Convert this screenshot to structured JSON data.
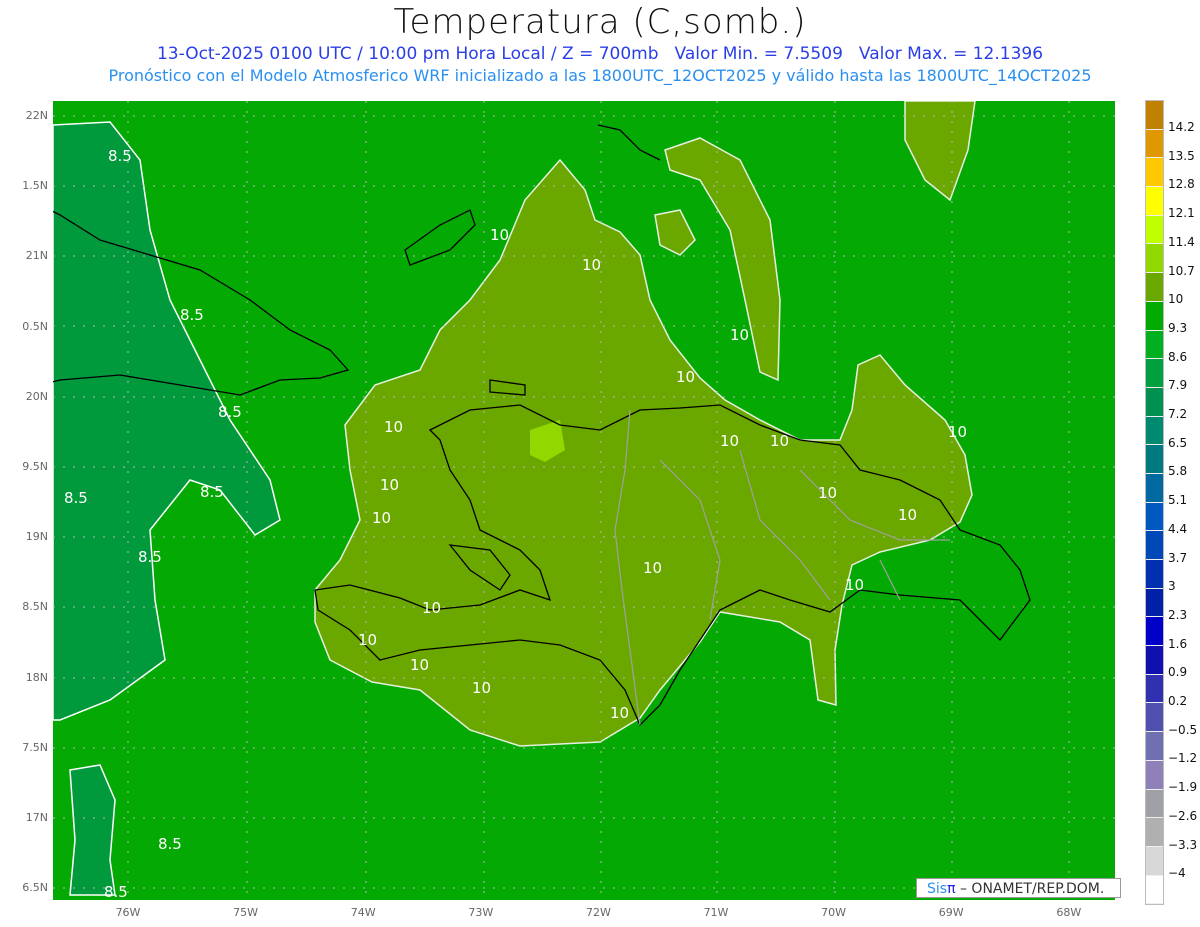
{
  "header": {
    "title": "Temperatura (C,somb.)",
    "date_line": "13-Oct-2025  0100 UTC / 10:00 pm Hora Local / Z = 700mb",
    "min_value": "Valor Min. = 7.5509",
    "max_value": "Valor Max. = 12.1396",
    "model_line": "Pronóstico con el Modelo Atmosferico WRF inicializado a las 1800UTC_12OCT2025 y válido hasta las  1800UTC_14OCT2025"
  },
  "axes": {
    "lat_labels": [
      "22N",
      "1.5N",
      "21N",
      "0.5N",
      "20N",
      "9.5N",
      "19N",
      "8.5N",
      "18N",
      "7.5N",
      "17N",
      "6.5N"
    ],
    "lon_labels": [
      "76W",
      "75W",
      "74W",
      "73W",
      "72W",
      "71W",
      "70W",
      "69W",
      "68W"
    ]
  },
  "colorbar": {
    "labels": [
      "14.2",
      "13.5",
      "12.8",
      "12.1",
      "11.4",
      "10.7",
      "10",
      "9.3",
      "8.6",
      "7.9",
      "7.2",
      "6.5",
      "5.8",
      "5.1",
      "4.4",
      "3.7",
      "3",
      "2.3",
      "1.6",
      "0.9",
      "0.2",
      "−0.5",
      "−1.2",
      "−1.9",
      "−2.6",
      "−3.3",
      "−4"
    ],
    "colors": [
      "#c08000",
      "#e09800",
      "#ffc800",
      "#ffff00",
      "#c0ff00",
      "#90d800",
      "#6aa800",
      "#00aa00",
      "#00b020",
      "#00a040",
      "#009050",
      "#008a70",
      "#007a80",
      "#006aa0",
      "#0058c0",
      "#0048b8",
      "#0030b0",
      "#0020a8",
      "#0000c8",
      "#1010b0",
      "#3030b0",
      "#5050b0",
      "#7070b0",
      "#9080b8",
      "#a0a0a8",
      "#b0b0b0",
      "#d8d8d8",
      "#ffffff"
    ]
  },
  "contour_labels": {
    "ten": "10",
    "eight_five": "8.5"
  },
  "logo": {
    "brand": "Sis",
    "pi": "π",
    "credit": "– ONAMET/REP.DOM."
  }
}
